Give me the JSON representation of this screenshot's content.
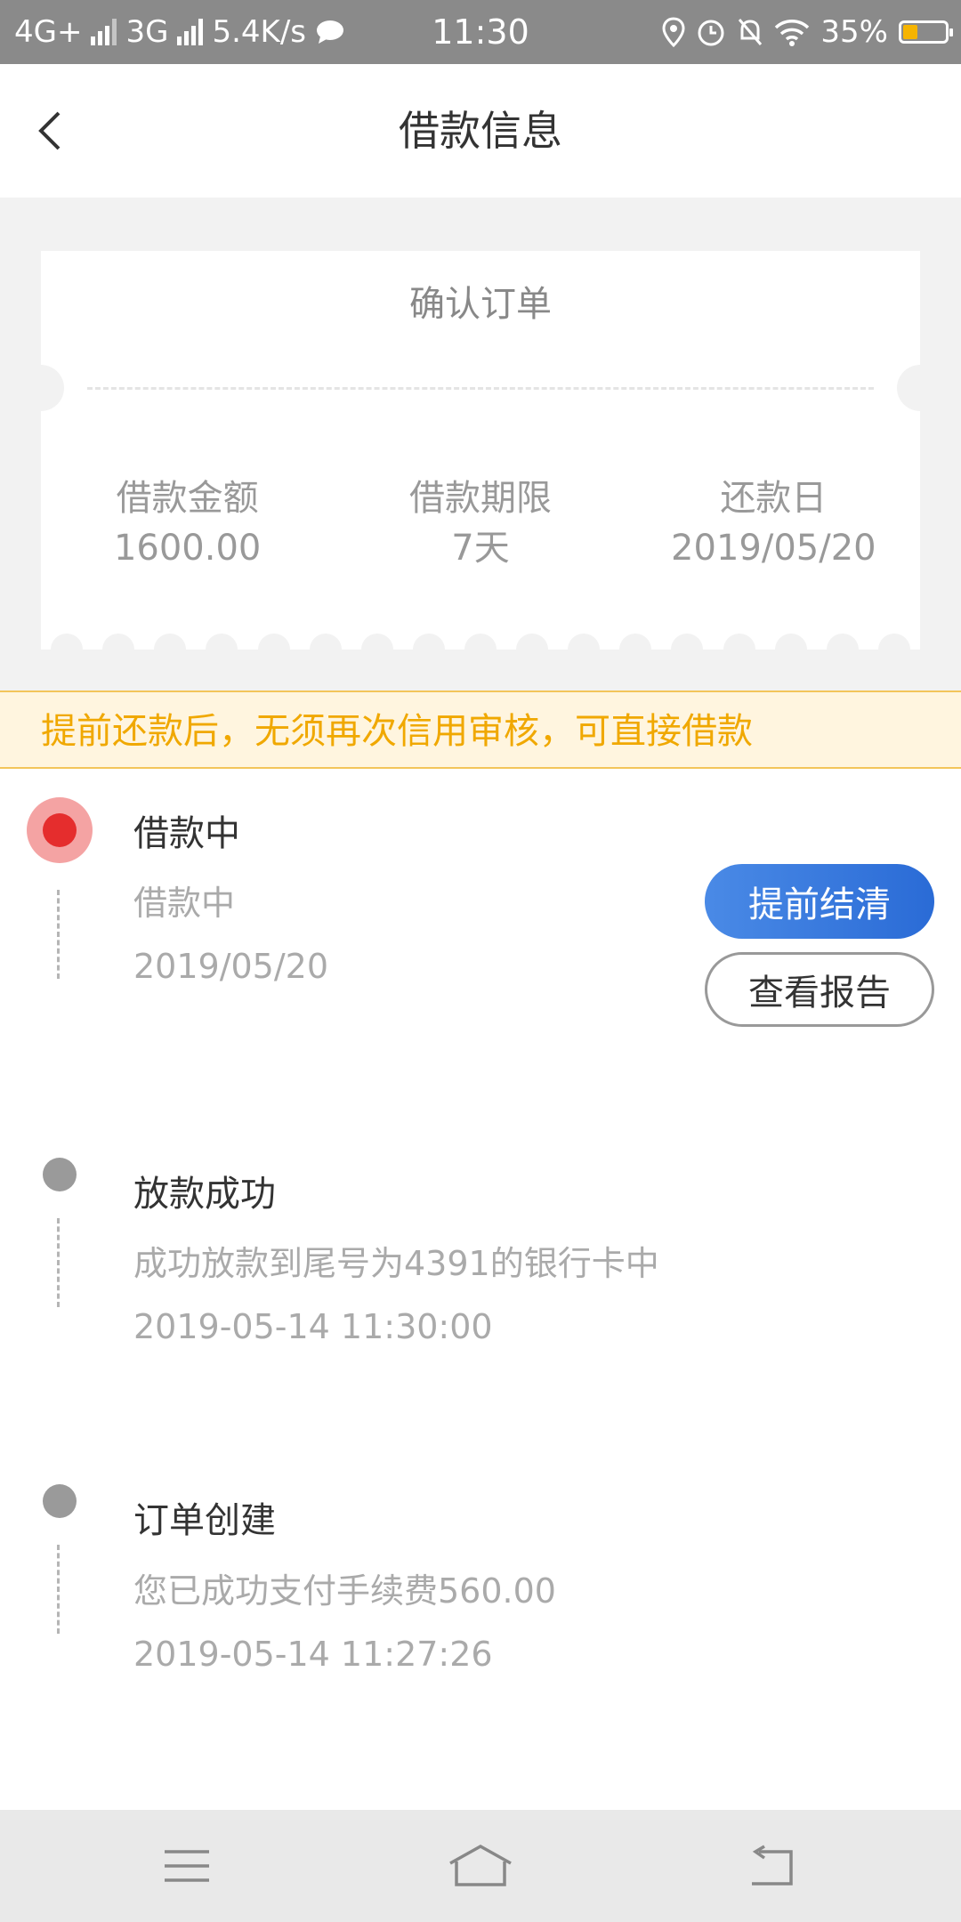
{
  "status_bar": {
    "network1": "4G+",
    "network2": "3G",
    "speed": "5.4K/s",
    "time": "11:30",
    "battery": "35%",
    "battery_level": 0.35,
    "icons": [
      "chat-icon",
      "location-icon",
      "alarm-icon",
      "mute-icon",
      "wifi-icon",
      "battery-icon"
    ]
  },
  "header": {
    "title": "借款信息"
  },
  "ticket": {
    "heading": "确认订单",
    "columns": [
      {
        "label": "借款金额",
        "value": "1600.00"
      },
      {
        "label": "借款期限",
        "value": "7天"
      },
      {
        "label": "还款日",
        "value": "2019/05/20"
      }
    ]
  },
  "notice": "提前还款后，无须再次信用审核，可直接借款",
  "timeline": {
    "steps": [
      {
        "title": "借款中",
        "desc": "借款中",
        "time": "2019/05/20",
        "status": "active"
      },
      {
        "title": "放款成功",
        "desc": "成功放款到尾号为4391的银行卡中",
        "time": "2019-05-14 11:30:00",
        "status": "done"
      },
      {
        "title": "订单创建",
        "desc": "您已成功支付手续费560.00",
        "time": "2019-05-14 11:27:26",
        "status": "done"
      }
    ],
    "primary_button": "提前结清",
    "secondary_button": "查看报告"
  },
  "colors": {
    "accent_blue": "#2a6bd6",
    "active_red": "#e52d2d",
    "notice_text": "#f0a800",
    "notice_bg": "#fff5df"
  },
  "nav_icons": [
    "menu-icon",
    "home-icon",
    "back-nav-icon"
  ]
}
